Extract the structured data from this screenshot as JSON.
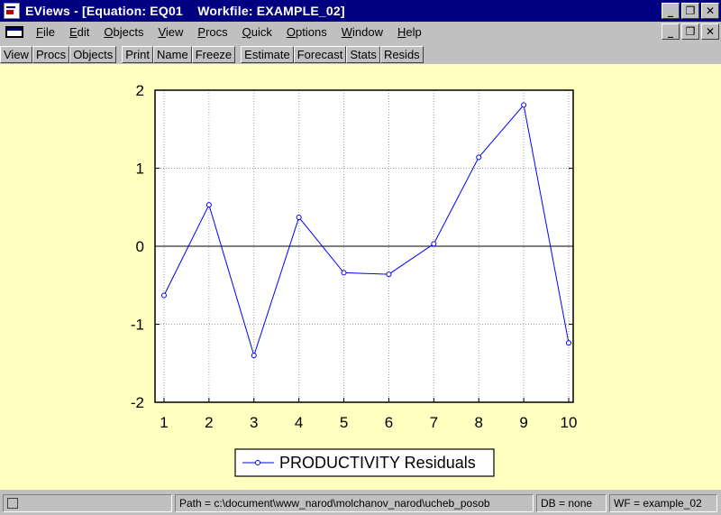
{
  "window": {
    "title": "EViews - [Equation: EQ01    Workfile: EXAMPLE_02]",
    "minimize": "_",
    "restore": "❐",
    "close": "✕"
  },
  "menu": {
    "items": [
      {
        "ul": "F",
        "rest": "ile"
      },
      {
        "ul": "E",
        "rest": "dit"
      },
      {
        "ul": "O",
        "rest": "bjects"
      },
      {
        "ul": "V",
        "rest": "iew"
      },
      {
        "ul": "P",
        "rest": "rocs"
      },
      {
        "ul": "Q",
        "rest": "uick"
      },
      {
        "ul": "O",
        "rest": "ptions"
      },
      {
        "ul": "W",
        "rest": "indow"
      },
      {
        "ul": "H",
        "rest": "elp"
      }
    ]
  },
  "toolbar": {
    "group1": [
      "View",
      "Procs",
      "Objects"
    ],
    "group2": [
      "Print",
      "Name",
      "Freeze"
    ],
    "group3": [
      "Estimate",
      "Forecast",
      "Stats",
      "Resids"
    ]
  },
  "chart_data": {
    "type": "line",
    "x": [
      1,
      2,
      3,
      4,
      5,
      6,
      7,
      8,
      9,
      10
    ],
    "series": [
      {
        "name": "PRODUCTIVITY Residuals",
        "values": [
          -0.63,
          0.53,
          -1.4,
          0.37,
          -0.34,
          -0.36,
          0.03,
          1.14,
          1.81,
          -1.24
        ]
      }
    ],
    "xticks": [
      "1",
      "2",
      "3",
      "4",
      "5",
      "6",
      "7",
      "8",
      "9",
      "10"
    ],
    "yticks": [
      "-2",
      "-1",
      "0",
      "1",
      "2"
    ],
    "ylim": [
      -2,
      2
    ],
    "xlim": [
      0.8,
      10.1
    ],
    "grid": true,
    "zero_line": true,
    "legend_position": "bottom",
    "line_color": "#0000ff",
    "background": "#ffffc0"
  },
  "status": {
    "path": "Path = c:\\document\\www_narod\\molchanov_narod\\ucheb_posob",
    "db": "DB = none",
    "wf": "WF = example_02"
  }
}
